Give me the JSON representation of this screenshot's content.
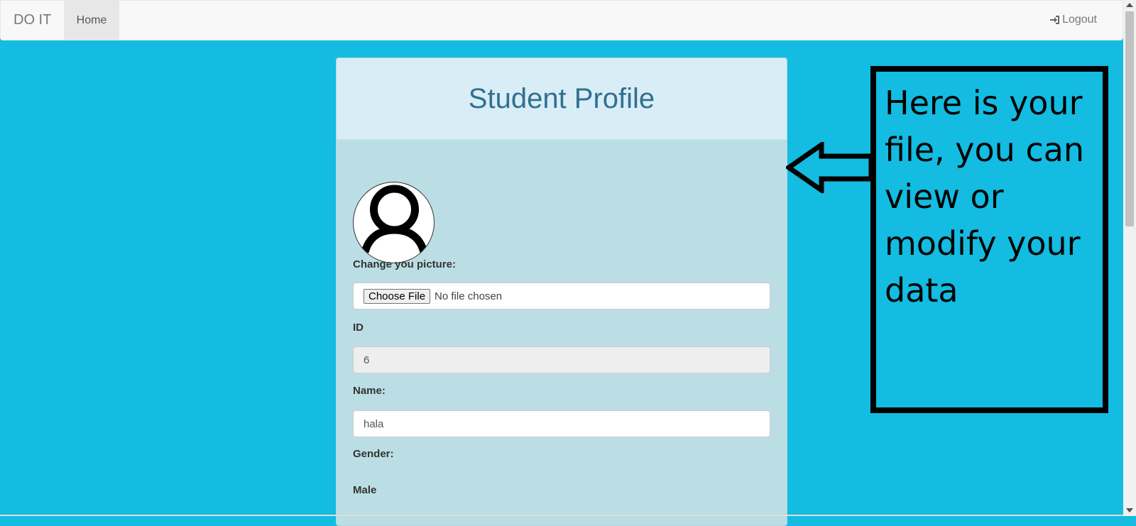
{
  "navbar": {
    "brand": "DO IT",
    "home_label": "Home",
    "logout_label": "Logout"
  },
  "panel": {
    "title": "Student Profile"
  },
  "form": {
    "picture_label": "Change you picture:",
    "choose_file_label": "Choose File",
    "file_status": "No file chosen",
    "id_label": "ID",
    "id_value": "6",
    "name_label": "Name:",
    "name_value": "hala",
    "gender_label": "Gender:",
    "gender_value": "Male"
  },
  "annotation": {
    "text": "Here is your file, you can view or modify your data"
  },
  "colors": {
    "background": "#13bce0",
    "panel_body": "#bbdee4",
    "panel_heading": "#d9edf7",
    "title_color": "#31708f"
  },
  "icons": {
    "logout": "logout-icon",
    "avatar": "user-avatar-icon",
    "arrow": "left-arrow-icon"
  }
}
